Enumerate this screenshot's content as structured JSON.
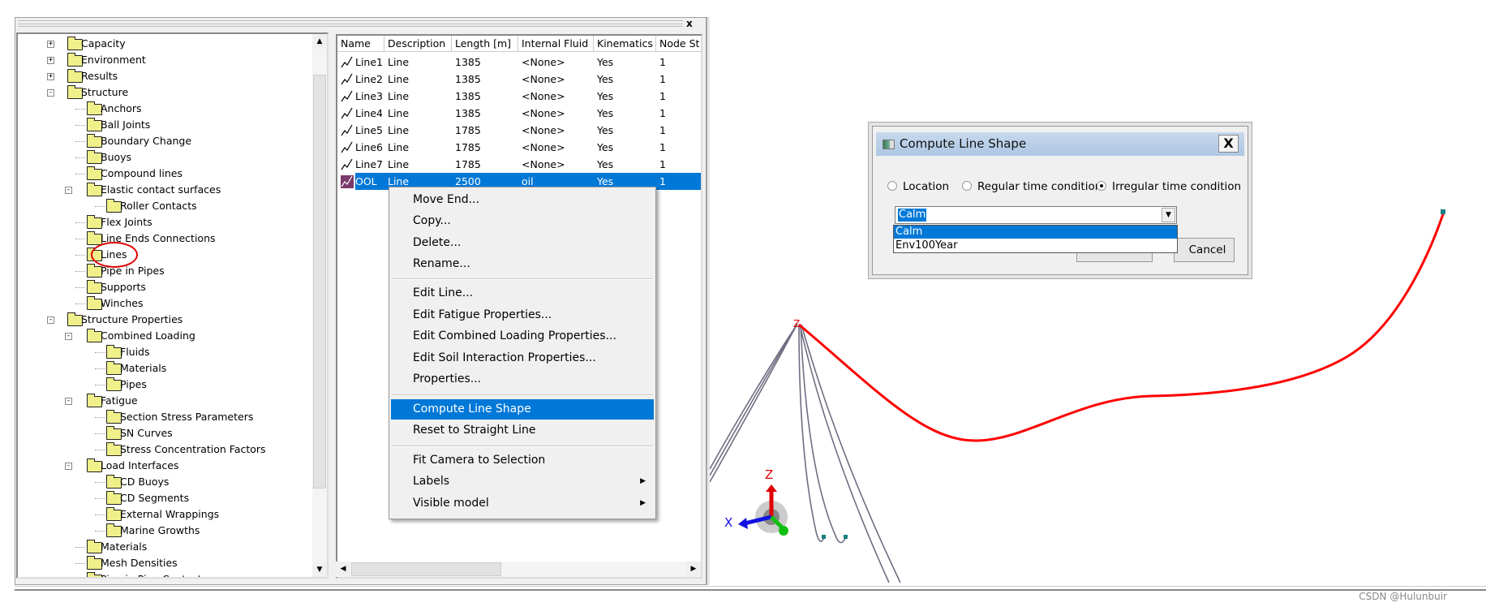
{
  "pane": {
    "close_label": "x"
  },
  "tree": {
    "items": [
      {
        "label": "Capacity",
        "level": 0,
        "toggle": "+"
      },
      {
        "label": "Environment",
        "level": 0,
        "toggle": "+"
      },
      {
        "label": "Results",
        "level": 0,
        "toggle": "+"
      },
      {
        "label": "Structure",
        "level": 0,
        "toggle": "-"
      },
      {
        "label": "Anchors",
        "level": 1,
        "toggle": ""
      },
      {
        "label": "Ball Joints",
        "level": 1,
        "toggle": ""
      },
      {
        "label": "Boundary Change",
        "level": 1,
        "toggle": ""
      },
      {
        "label": "Buoys",
        "level": 1,
        "toggle": ""
      },
      {
        "label": "Compound lines",
        "level": 1,
        "toggle": ""
      },
      {
        "label": "Elastic contact surfaces",
        "level": 1,
        "toggle": "-"
      },
      {
        "label": "Roller Contacts",
        "level": 2,
        "toggle": ""
      },
      {
        "label": "Flex Joints",
        "level": 1,
        "toggle": ""
      },
      {
        "label": "Line Ends Connections",
        "level": 1,
        "toggle": ""
      },
      {
        "label": "Lines",
        "level": 1,
        "toggle": "",
        "annotated": true
      },
      {
        "label": "Pipe in Pipes",
        "level": 1,
        "toggle": ""
      },
      {
        "label": "Supports",
        "level": 1,
        "toggle": ""
      },
      {
        "label": "Winches",
        "level": 1,
        "toggle": ""
      },
      {
        "label": "Structure Properties",
        "level": 0,
        "toggle": "-"
      },
      {
        "label": "Combined Loading",
        "level": 1,
        "toggle": "-"
      },
      {
        "label": "Fluids",
        "level": 2,
        "toggle": ""
      },
      {
        "label": "Materials",
        "level": 2,
        "toggle": ""
      },
      {
        "label": "Pipes",
        "level": 2,
        "toggle": ""
      },
      {
        "label": "Fatigue",
        "level": 1,
        "toggle": "-"
      },
      {
        "label": "Section Stress Parameters",
        "level": 2,
        "toggle": ""
      },
      {
        "label": "SN Curves",
        "level": 2,
        "toggle": ""
      },
      {
        "label": "Stress Concentration Factors",
        "level": 2,
        "toggle": ""
      },
      {
        "label": "Load Interfaces",
        "level": 1,
        "toggle": "-"
      },
      {
        "label": "CD Buoys",
        "level": 2,
        "toggle": ""
      },
      {
        "label": "CD Segments",
        "level": 2,
        "toggle": ""
      },
      {
        "label": "External Wrappings",
        "level": 2,
        "toggle": ""
      },
      {
        "label": "Marine Growths",
        "level": 2,
        "toggle": ""
      },
      {
        "label": "Materials",
        "level": 1,
        "toggle": ""
      },
      {
        "label": "Mesh Densities",
        "level": 1,
        "toggle": ""
      },
      {
        "label": "Pipe in Pipe Contact",
        "level": 1,
        "toggle": ""
      }
    ]
  },
  "table": {
    "columns": [
      "Name",
      "Description",
      "Length [m]",
      "Internal Fluid",
      "Kinematics",
      "Node St"
    ],
    "rows": [
      [
        "Line1",
        "Line",
        "1385",
        "<None>",
        "Yes",
        "1"
      ],
      [
        "Line2",
        "Line",
        "1385",
        "<None>",
        "Yes",
        "1"
      ],
      [
        "Line3",
        "Line",
        "1385",
        "<None>",
        "Yes",
        "1"
      ],
      [
        "Line4",
        "Line",
        "1385",
        "<None>",
        "Yes",
        "1"
      ],
      [
        "Line5",
        "Line",
        "1785",
        "<None>",
        "Yes",
        "1"
      ],
      [
        "Line6",
        "Line",
        "1785",
        "<None>",
        "Yes",
        "1"
      ],
      [
        "Line7",
        "Line",
        "1785",
        "<None>",
        "Yes",
        "1"
      ],
      [
        "OOL",
        "Line",
        "2500",
        "oil",
        "Yes",
        "1"
      ]
    ],
    "selected_row": 7
  },
  "context_menu": {
    "items": [
      {
        "label": "Move End..."
      },
      {
        "label": "Copy..."
      },
      {
        "label": "Delete..."
      },
      {
        "label": "Rename..."
      },
      {
        "separator": true
      },
      {
        "label": "Edit Line..."
      },
      {
        "label": "Edit Fatigue Properties..."
      },
      {
        "label": "Edit Combined Loading Properties..."
      },
      {
        "label": "Edit Soil Interaction Properties..."
      },
      {
        "label": "Properties..."
      },
      {
        "separator": true
      },
      {
        "label": "Compute Line Shape",
        "highlighted": true
      },
      {
        "label": "Reset to Straight Line"
      },
      {
        "separator": true
      },
      {
        "label": "Fit Camera to Selection"
      },
      {
        "label": "Labels",
        "submenu": true
      },
      {
        "label": "Visible model",
        "submenu": true
      }
    ]
  },
  "dialog": {
    "title": "Compute Line Shape",
    "close_label": "X",
    "radios": [
      {
        "label": "Location",
        "checked": false
      },
      {
        "label": "Regular time condition",
        "checked": false
      },
      {
        "label": "Irregular time condition",
        "checked": true
      }
    ],
    "combo_value": "Calm",
    "options": [
      "Calm",
      "Env100Year"
    ],
    "cancel_label": "Cancel"
  },
  "view": {
    "axis_labels": {
      "z": "Z",
      "x": "X"
    },
    "colors": {
      "selected_line": "#ff0000",
      "lines": "#6e6e82",
      "axis_z": "#e00000",
      "axis_x": "#1010e0",
      "axis_y": "#10c010"
    }
  },
  "watermark": "CSDN @Hulunbuir"
}
